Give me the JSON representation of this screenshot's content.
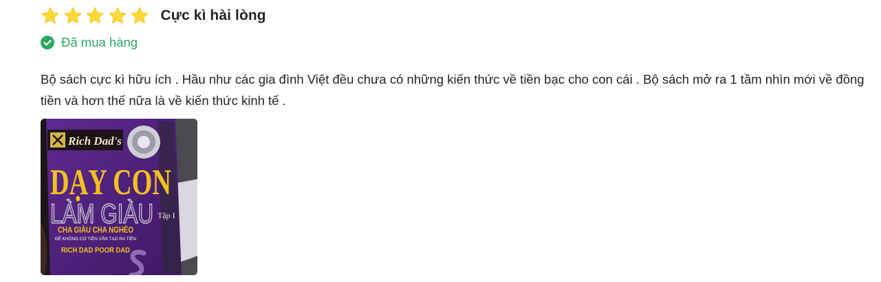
{
  "review": {
    "rating": 5,
    "rating_max": 5,
    "star_color": "#fdd836",
    "rating_title": "Cực kì hài lòng",
    "purchased_label": "Đã mua hàng",
    "purchased_color": "#2ba861",
    "content": "Bộ sách cực kì hữu ích . Hầu như các gia đình Việt đều chưa có những kiến thức về tiền bạc cho con cái . Bộ sách mở ra 1 tầm nhìn mới về đồng tiền và hơn thế nữa là về kiến thức kinh tế .",
    "photo": {
      "brand": "Rich Dad's",
      "title_line1": "DẠY CON",
      "title_line2": "LÀM GIÀU",
      "volume": "Tập I",
      "subtitle": "CHA GIÀU CHA NGHÈO",
      "tagline": "ĐỂ KHÔNG CÓ TIỀN VẪN TẠO RA TIỀN",
      "english_title": "RICH DAD POOR DAD"
    }
  }
}
